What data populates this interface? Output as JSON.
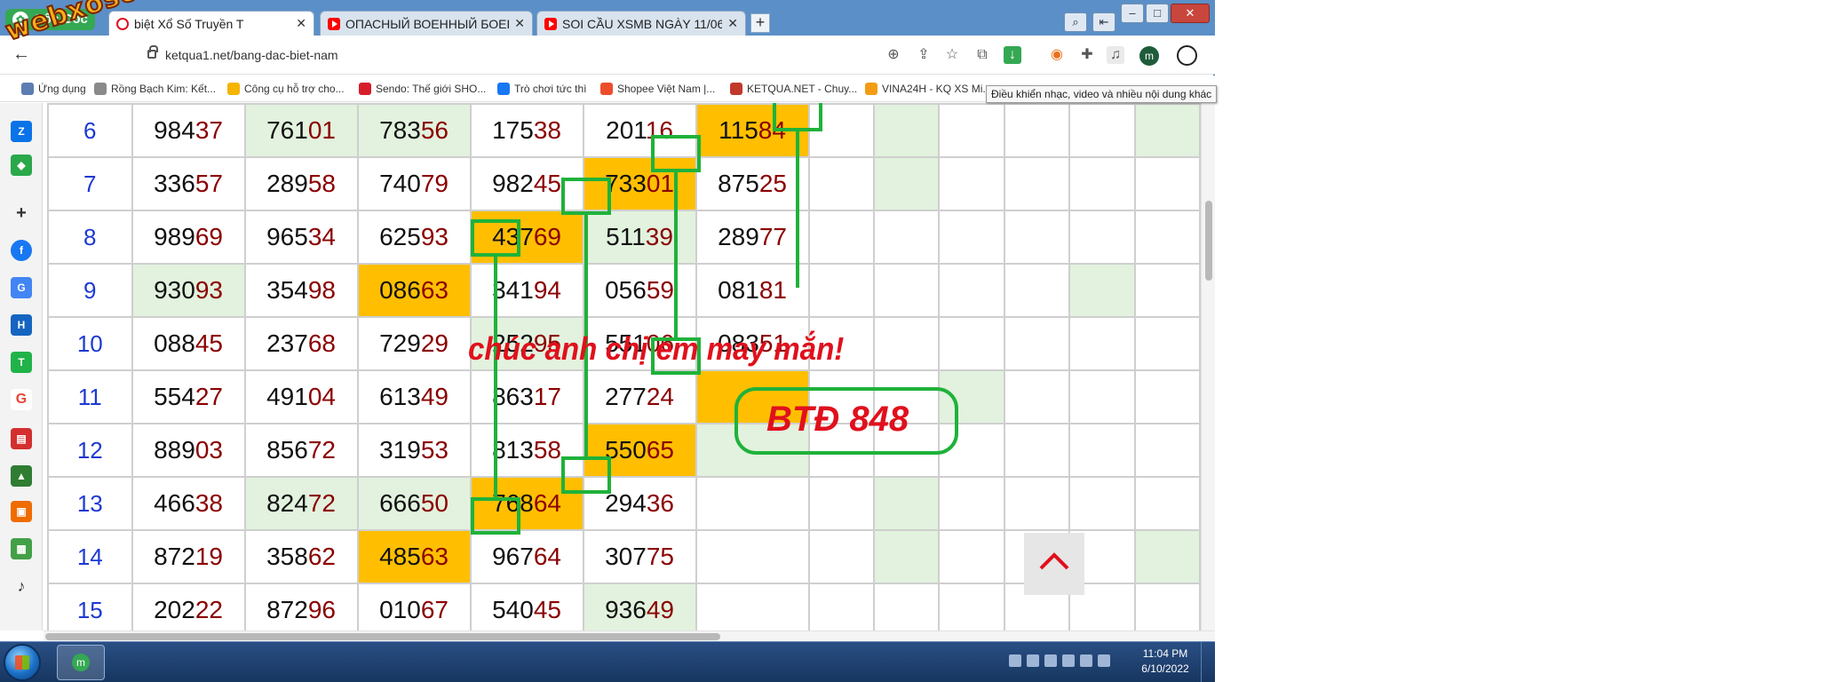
{
  "browser": {
    "brand": "Cốc Cốc",
    "tabs": [
      {
        "title": "biệt Xổ Số Truyền T",
        "close": "✕"
      },
      {
        "title": "ОПАСНЫЙ ВОЕННЫЙ БОЕВ",
        "close": "✕"
      },
      {
        "title": "SOI CẦU XSMB NGÀY 11/06",
        "close": "✕"
      }
    ],
    "new_tab": "+",
    "window_buttons": {
      "minimize": "–",
      "maximize": "□",
      "close": "✕"
    },
    "url": "ketqua1.net/bang-dac-biet-nam",
    "profile_initial": "m",
    "bookmarks": [
      {
        "label": "Ứng dụng",
        "color": "#5b7db1"
      },
      {
        "label": "Rồng Bạch Kim: Kết...",
        "color": "#8a8a8a"
      },
      {
        "label": "Công cụ hỗ trợ cho...",
        "color": "#f4b400"
      },
      {
        "label": "Sendo: Thế giới SHO...",
        "color": "#d61e2b"
      },
      {
        "label": "Trò chơi tức thì",
        "color": "#1877f2"
      },
      {
        "label": "Shopee Việt Nam |...",
        "color": "#ee4d2d"
      },
      {
        "label": "KETQUA.NET - Chuy...",
        "color": "#c0392b"
      },
      {
        "label": "VINA24H - KQ XS Mi...",
        "color": "#f39c12"
      }
    ],
    "tooltip": "Điều khiển nhạc, video và nhiều nội dung khác"
  },
  "watermark": "webxoso.net",
  "colors": {
    "accent_green": "#1fb23a",
    "highlight_orange": "#ffbf00",
    "light_green": "#e2f2de",
    "digit_red": "#8b0000",
    "row_blue": "#1d39d2",
    "message_red": "#e0101c"
  },
  "table": {
    "rows": [
      {
        "label": "6",
        "cells": [
          {
            "h": "984",
            "t": "37"
          },
          {
            "h": "761",
            "t": "01",
            "bg": "g"
          },
          {
            "h": "783",
            "t": "56",
            "bg": "g"
          },
          {
            "h": "175",
            "t": "38"
          },
          {
            "h": "201",
            "t": "16"
          },
          {
            "h": "115",
            "t": "84",
            "bg": "o"
          }
        ]
      },
      {
        "label": "7",
        "cells": [
          {
            "h": "336",
            "t": "57"
          },
          {
            "h": "289",
            "t": "58"
          },
          {
            "h": "740",
            "t": "79"
          },
          {
            "h": "982",
            "t": "45"
          },
          {
            "h": "733",
            "t": "01",
            "bg": "o"
          },
          {
            "h": "875",
            "t": "25"
          }
        ]
      },
      {
        "label": "8",
        "cells": [
          {
            "h": "989",
            "t": "69"
          },
          {
            "h": "965",
            "t": "34"
          },
          {
            "h": "625",
            "t": "93"
          },
          {
            "h": "437",
            "t": "69",
            "bg": "o"
          },
          {
            "h": "511",
            "t": "39",
            "bg": "g"
          },
          {
            "h": "289",
            "t": "77"
          }
        ]
      },
      {
        "label": "9",
        "cells": [
          {
            "h": "930",
            "t": "93",
            "bg": "g"
          },
          {
            "h": "354",
            "t": "98"
          },
          {
            "h": "086",
            "t": "63",
            "bg": "o"
          },
          {
            "h": "341",
            "t": "94"
          },
          {
            "h": "056",
            "t": "59"
          },
          {
            "h": "081",
            "t": "81"
          }
        ]
      },
      {
        "label": "10",
        "cells": [
          {
            "h": "088",
            "t": "45"
          },
          {
            "h": "237",
            "t": "68"
          },
          {
            "h": "729",
            "t": "29"
          },
          {
            "h": "252",
            "t": "95",
            "bg": "g"
          },
          {
            "h": "551",
            "t": "06"
          },
          {
            "h": "083",
            "t": "51"
          }
        ]
      },
      {
        "label": "11",
        "cells": [
          {
            "h": "554",
            "t": "27"
          },
          {
            "h": "491",
            "t": "04"
          },
          {
            "h": "613",
            "t": "49"
          },
          {
            "h": "863",
            "t": "17"
          },
          {
            "h": "277",
            "t": "24"
          },
          {
            "h": "",
            "t": "",
            "bg": "o"
          }
        ]
      },
      {
        "label": "12",
        "cells": [
          {
            "h": "889",
            "t": "03"
          },
          {
            "h": "856",
            "t": "72"
          },
          {
            "h": "319",
            "t": "53"
          },
          {
            "h": "813",
            "t": "58"
          },
          {
            "h": "550",
            "t": "65",
            "bg": "o"
          },
          {
            "h": "",
            "t": "",
            "bg": "g"
          }
        ]
      },
      {
        "label": "13",
        "cells": [
          {
            "h": "466",
            "t": "38"
          },
          {
            "h": "824",
            "t": "72",
            "bg": "g"
          },
          {
            "h": "666",
            "t": "50",
            "bg": "g"
          },
          {
            "h": "768",
            "t": "64",
            "bg": "o"
          },
          {
            "h": "294",
            "t": "36"
          },
          {
            "h": "",
            "t": ""
          }
        ]
      },
      {
        "label": "14",
        "cells": [
          {
            "h": "872",
            "t": "19"
          },
          {
            "h": "358",
            "t": "62"
          },
          {
            "h": "485",
            "t": "63",
            "bg": "o"
          },
          {
            "h": "967",
            "t": "64"
          },
          {
            "h": "307",
            "t": "75"
          },
          {
            "h": "",
            "t": ""
          }
        ]
      },
      {
        "label": "15",
        "cells": [
          {
            "h": "202",
            "t": "22"
          },
          {
            "h": "872",
            "t": "96"
          },
          {
            "h": "010",
            "t": "67"
          },
          {
            "h": "540",
            "t": "45"
          },
          {
            "h": "936",
            "t": "49",
            "bg": "g"
          },
          {
            "h": "",
            "t": ""
          }
        ]
      }
    ],
    "extra_green": [
      [
        0,
        1
      ],
      [
        0,
        5
      ],
      [
        1,
        1
      ],
      [
        3,
        4
      ],
      [
        5,
        2
      ],
      [
        7,
        1
      ],
      [
        8,
        1
      ],
      [
        8,
        5
      ]
    ]
  },
  "annotation": {
    "message": "chúc anh chị em may mắn!",
    "prediction": "BTĐ 848"
  },
  "taskbar": {
    "time": "11:04 PM",
    "date": "6/10/2022"
  }
}
